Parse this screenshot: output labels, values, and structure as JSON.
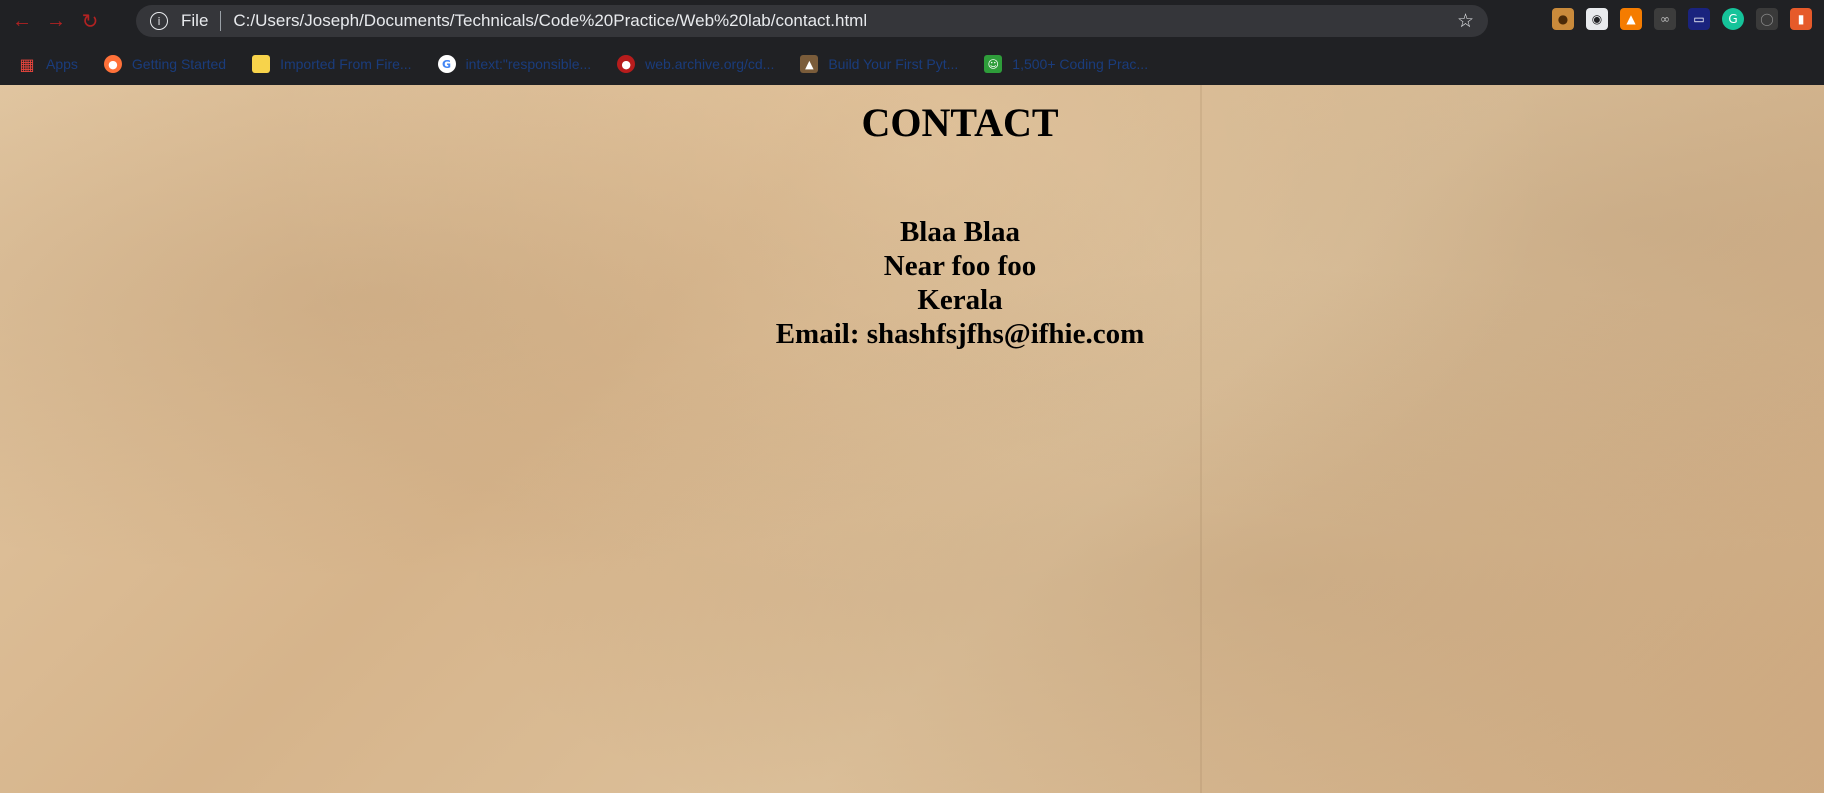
{
  "browser": {
    "address_scheme": "File",
    "url": "C:/Users/Joseph/Documents/Technicals/Code%20Practice/Web%20lab/contact.html",
    "bookmarks": [
      {
        "label": "Apps",
        "icon": "apps-grid-icon",
        "color": "#e8453c"
      },
      {
        "label": "Getting Started",
        "icon": "firefox-icon",
        "color": "#ff7139"
      },
      {
        "label": "Imported From Fire...",
        "icon": "folder-icon",
        "color": "#f7d34b"
      },
      {
        "label": "intext:\"responsible...",
        "icon": "google-icon",
        "color": "#ffffff"
      },
      {
        "label": "web.archive.org/cd...",
        "icon": "archive-icon",
        "color": "#b71c1c"
      },
      {
        "label": "Build Your First Pyt...",
        "icon": "python-icon",
        "color": "#7a5c3a"
      },
      {
        "label": "1,500+ Coding Prac...",
        "icon": "coding-icon",
        "color": "#2e9d3a"
      }
    ]
  },
  "page": {
    "title": "CONTACT",
    "address_lines": [
      "Blaa Blaa",
      "Near foo foo",
      "Kerala",
      "Email: shashfsjfhs@ifhie.com"
    ]
  }
}
